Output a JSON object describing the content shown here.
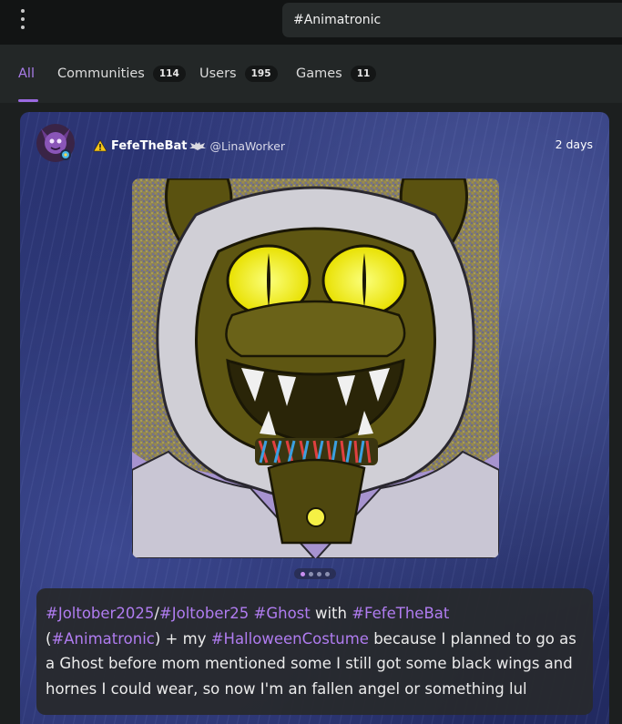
{
  "header": {
    "menu_icon": "kebab-menu-icon",
    "search_value": "#Animatronic"
  },
  "tabs": [
    {
      "label": "All",
      "count": null,
      "active": true
    },
    {
      "label": "Communities",
      "count": "114"
    },
    {
      "label": "Users",
      "count": "195"
    },
    {
      "label": "Games",
      "count": "11"
    }
  ],
  "post": {
    "author_name": "FefeTheBat",
    "author_handle": "@LinaWorker",
    "badge_icons": [
      "warning-icon",
      "bat-icon"
    ],
    "timestamp": "2 days",
    "image_count": 4,
    "current_image": 1,
    "caption": {
      "tag1": "#Joltober2025",
      "sep1": "/",
      "tag2": "#Joltober25",
      "sep2": " ",
      "tag3": "#Ghost",
      "text1": " with ",
      "tag4": "#FefeTheBat",
      "text2": " (",
      "tag5": "#Animatronic",
      "text3": ") + my ",
      "tag6": "#HalloweenCostume",
      "text4": " because I planned to go as a Ghost before mom mentioned some I still got some black wings and hornes I could wear, so now I'm an fallen angel or something lul"
    }
  },
  "colors": {
    "accent": "#a97ce8",
    "tag": "#b07cf0",
    "background": "#1c1f1f",
    "card": "#26306a"
  }
}
